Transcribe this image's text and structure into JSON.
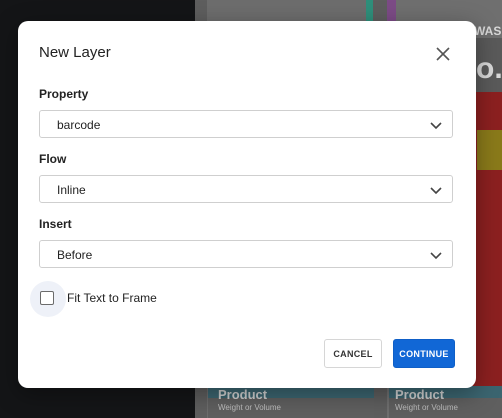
{
  "background": {
    "banner_text": "WAS $",
    "big_text": "o.c",
    "cards": [
      {
        "title": "Product",
        "subtitle": "Weight or Volume"
      },
      {
        "title": "Product",
        "subtitle": "Weight or Volume"
      }
    ]
  },
  "dialog": {
    "title": "New Layer",
    "close_icon": "close-icon",
    "fields": [
      {
        "label": "Property",
        "value": "barcode"
      },
      {
        "label": "Flow",
        "value": "Inline"
      },
      {
        "label": "Insert",
        "value": "Before"
      }
    ],
    "checkbox": {
      "label": "Fit Text to Frame",
      "checked": false
    },
    "buttons": {
      "cancel": "CANCEL",
      "continue": "CONTINUE"
    }
  },
  "colors": {
    "primary": "#1167d6",
    "overlay": "#111214"
  }
}
